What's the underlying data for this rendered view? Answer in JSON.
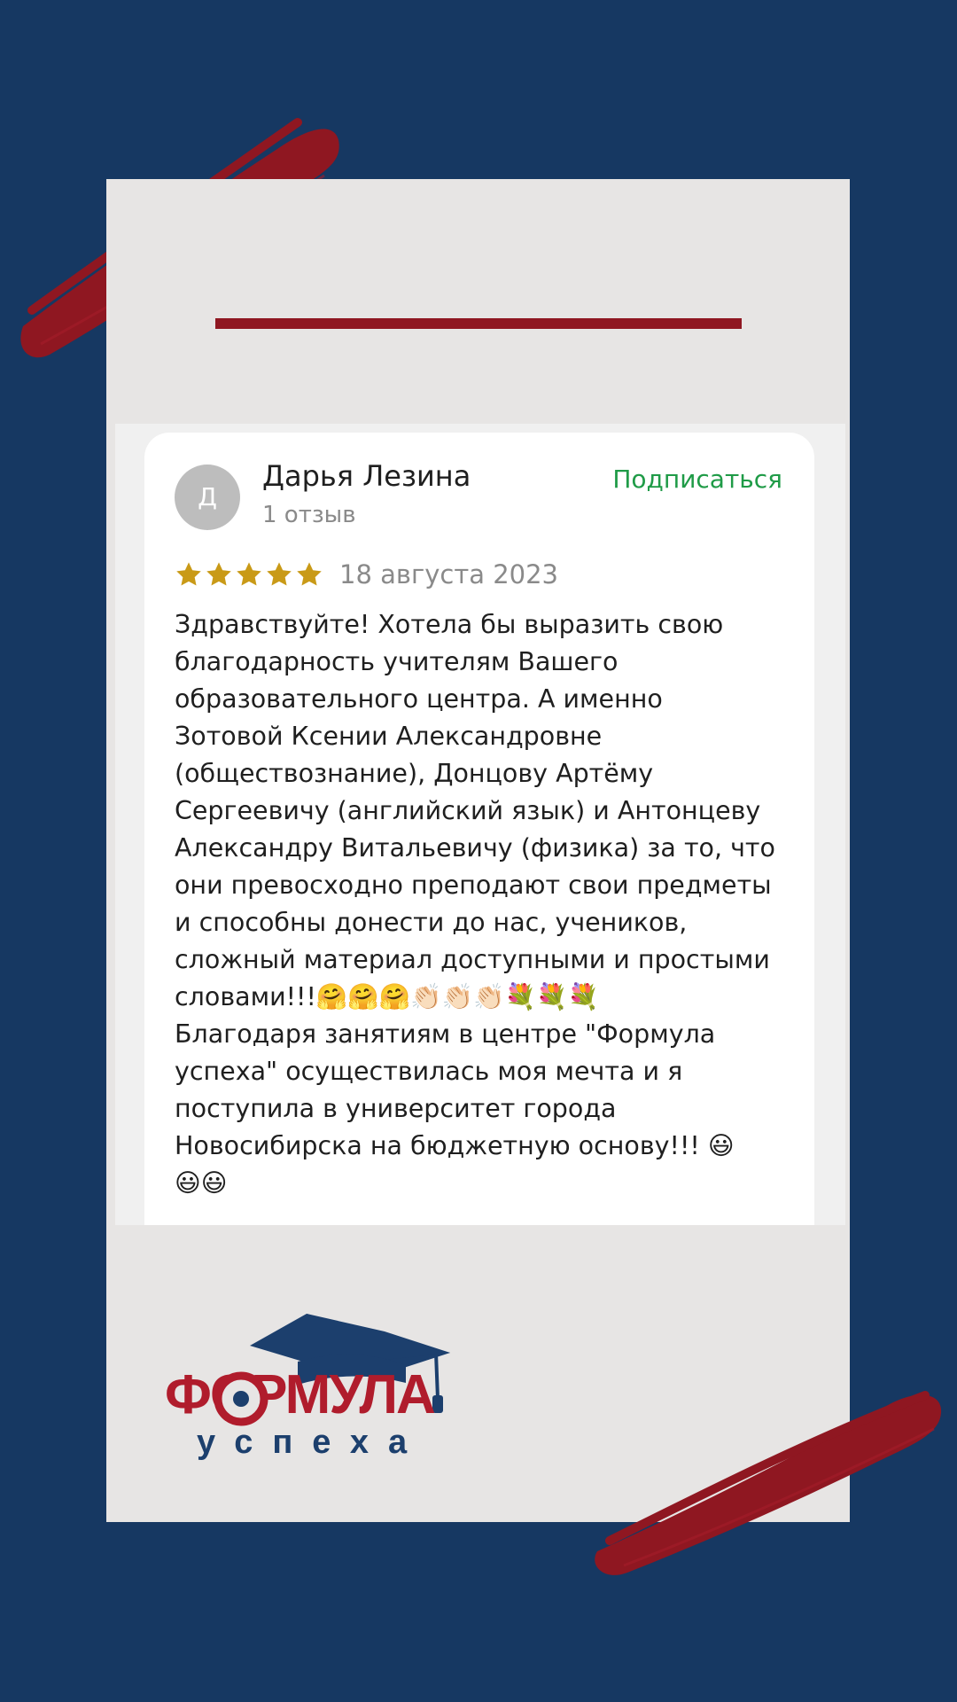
{
  "review": {
    "avatar_letter": "Д",
    "author": "Дарья Лезина",
    "review_count": "1 отзыв",
    "subscribe_label": "Подписаться",
    "rating": 5,
    "rating_max": 5,
    "date": "18 августа 2023",
    "text_lines": [
      "Здравствуйте! Хотела бы выразить свою",
      "благодарность учителям Вашего",
      "образовательного центра. А именно",
      "Зотовой Ксении Александровне",
      "(обществознание), Донцову Артёму",
      "Сергеевичу (английский язык) и Антонцеву",
      "Александру Витальевичу (физика) за то, что",
      "они превосходно преподают свои предметы",
      "и способны донести до нас, учеников,",
      "сложный материал доступными и простыми",
      "словами!!!🤗🤗🤗👏🏻👏🏻👏🏻💐💐💐",
      "Благодаря занятиям в центре \"Формула",
      "успеха\" осуществилась моя мечта и я",
      "поступила в университет города",
      "Новосибирска на бюджетную основу!!! 😃",
      "😃😃"
    ]
  },
  "logo": {
    "word": "ФОРМУЛА",
    "subword": "успеха"
  },
  "colors": {
    "background": "#163862",
    "card": "#e7e5e4",
    "accent_red": "#8f1721",
    "star": "#c99a17",
    "subscribe_green": "#1f9b47"
  }
}
